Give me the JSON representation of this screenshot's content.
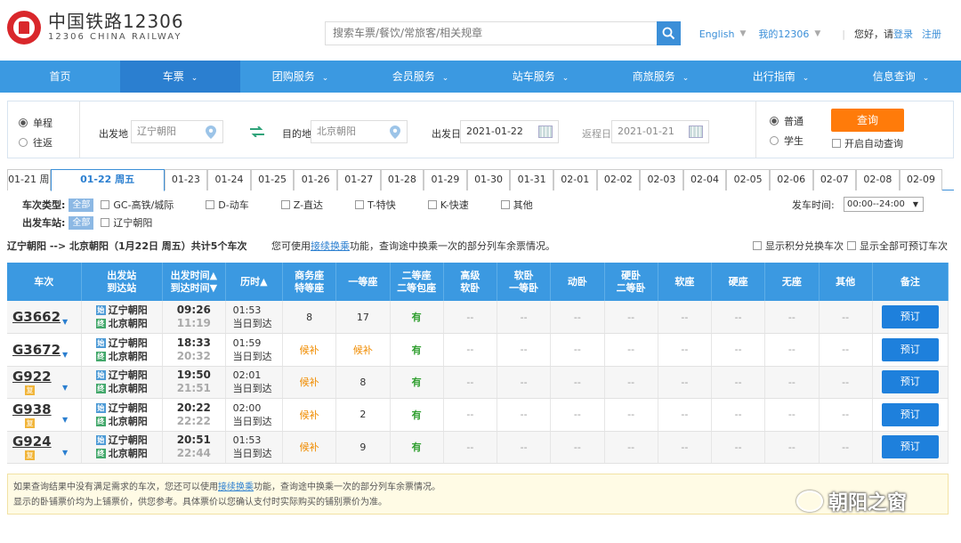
{
  "brand": {
    "cn": "中国铁路12306",
    "en": "12306 CHINA RAILWAY",
    "color": "#d9272b"
  },
  "search": {
    "placeholder": "搜索车票/餐饮/常旅客/相关规章"
  },
  "top_links": {
    "english": "English",
    "my12306": "我的12306",
    "hello": "您好，请",
    "login": "登录",
    "register": "注册"
  },
  "nav": [
    "首页",
    "车票",
    "团购服务",
    "会员服务",
    "站车服务",
    "商旅服务",
    "出行指南",
    "信息查询"
  ],
  "form": {
    "one_way": "单程",
    "round_trip": "往返",
    "from_label": "出发地",
    "from_value": "辽宁朝阳",
    "to_label": "目的地",
    "to_value": "北京朝阳",
    "depart_label": "出发日",
    "depart_value": "2021-01-22",
    "return_label": "返程日",
    "return_value": "2021-01-21",
    "normal": "普通",
    "student": "学生",
    "query": "查询",
    "auto_query": "开启自动查询"
  },
  "dates": [
    "01-21 周",
    "01-22 周五",
    "01-23",
    "01-24",
    "01-25",
    "01-26",
    "01-27",
    "01-28",
    "01-29",
    "01-30",
    "01-31",
    "02-01",
    "02-02",
    "02-03",
    "02-04",
    "02-05",
    "02-06",
    "02-07",
    "02-08",
    "02-09"
  ],
  "filters": {
    "type_label": "车次类型:",
    "all": "全部",
    "types": [
      "GC-高铁/城际",
      "D-动车",
      "Z-直达",
      "T-特快",
      "K-快速",
      "其他"
    ],
    "station_label": "出发车站:",
    "station_all": "全部",
    "station": "辽宁朝阳",
    "time_label": "发车时间:",
    "time_value": "00:00--24:00"
  },
  "summary": {
    "route": "辽宁朝阳 --> 北京朝阳（1月22日 周五）共计5个车次",
    "tip_pre": "您可使用",
    "tip_link": "接续换乘",
    "tip_post": "功能，查询途中换乘一次的部分列车余票情况。",
    "opt1": "显示积分兑换车次",
    "opt2": "显示全部可预订车次"
  },
  "table": {
    "headers": [
      "车次",
      "出发站\n到达站",
      "出发时间▲\n到达时间▼",
      "历时▲",
      "商务座\n特等座",
      "一等座",
      "二等座\n二等包座",
      "高级\n软卧",
      "软卧\n一等卧",
      "动卧",
      "硬卧\n二等卧",
      "软座",
      "硬座",
      "无座",
      "其他",
      "备注"
    ],
    "rows": [
      {
        "no": "G3662",
        "mini": "",
        "from": "辽宁朝阳",
        "to": "北京朝阳",
        "dep": "09:26",
        "arr": "11:19",
        "dur": "01:53",
        "day": "当日到达",
        "biz": "8",
        "first": "17",
        "second": "有",
        "book": "预订"
      },
      {
        "no": "G3672",
        "mini": "",
        "from": "辽宁朝阳",
        "to": "北京朝阳",
        "dep": "18:33",
        "arr": "20:32",
        "dur": "01:59",
        "day": "当日到达",
        "biz": "候补",
        "first": "候补",
        "second": "有",
        "book": "预订"
      },
      {
        "no": "G922",
        "mini": "复",
        "from": "辽宁朝阳",
        "to": "北京朝阳",
        "dep": "19:50",
        "arr": "21:51",
        "dur": "02:01",
        "day": "当日到达",
        "biz": "候补",
        "first": "8",
        "second": "有",
        "book": "预订"
      },
      {
        "no": "G938",
        "mini": "复",
        "from": "辽宁朝阳",
        "to": "北京朝阳",
        "dep": "20:22",
        "arr": "22:22",
        "dur": "02:00",
        "day": "当日到达",
        "biz": "候补",
        "first": "2",
        "second": "有",
        "book": "预订"
      },
      {
        "no": "G924",
        "mini": "复",
        "from": "辽宁朝阳",
        "to": "北京朝阳",
        "dep": "20:51",
        "arr": "22:44",
        "dur": "01:53",
        "day": "当日到达",
        "biz": "候补",
        "first": "9",
        "second": "有",
        "book": "预订"
      }
    ],
    "dash": "--",
    "start_badge": "始",
    "end_badge": "终"
  },
  "note": {
    "line1_pre": "如果查询结果中没有满足需求的车次，您还可以使用",
    "line1_link": "接续换乘",
    "line1_post": "功能，查询途中换乘一次的部分列车余票情况。",
    "line2": "显示的卧铺票价均为上铺票价，供您参考。具体票价以您确认支付时实际购买的铺别票价为准。"
  },
  "watermark": "朝阳之窗"
}
